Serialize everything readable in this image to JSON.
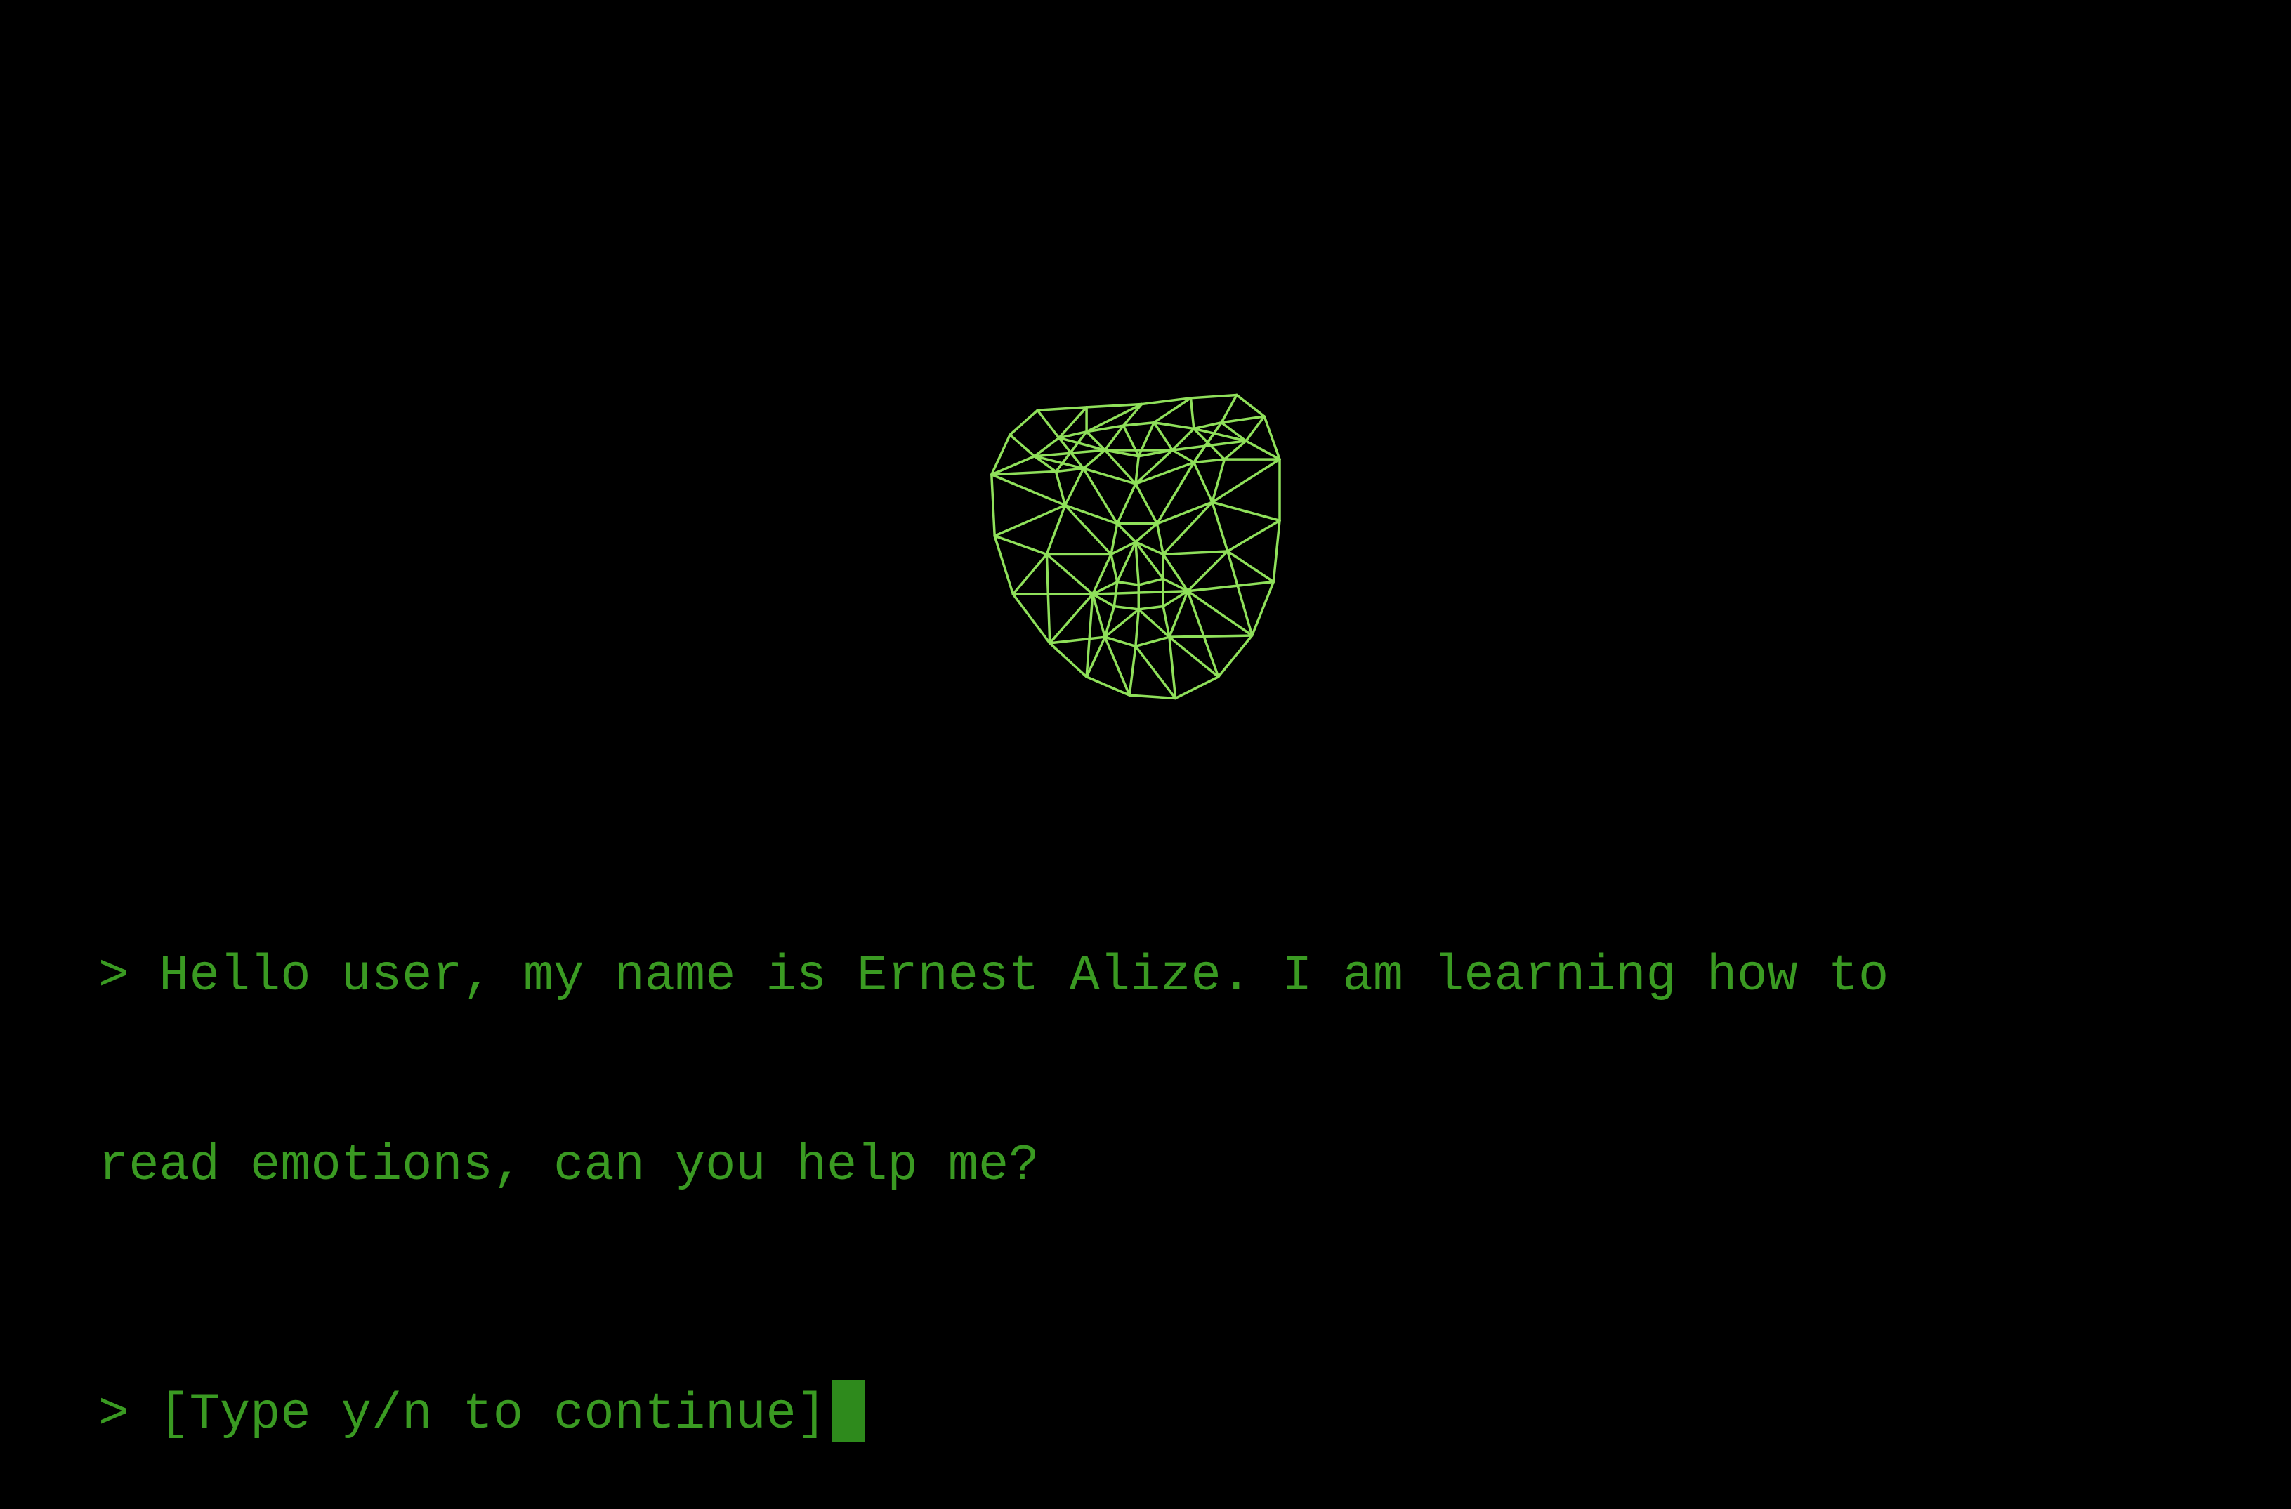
{
  "colors": {
    "background": "#000000",
    "mesh": "#8fe05a",
    "text": "#3a9a22",
    "cursor": "#2e8a1c"
  },
  "face": {
    "icon": "wireframe-face-icon"
  },
  "terminal": {
    "message_line1": "> Hello user, my name is Ernest Alize. I am learning how to",
    "message_line2": "read emotions, can you help me?",
    "prompt": "> [Type y/n to continue]"
  }
}
